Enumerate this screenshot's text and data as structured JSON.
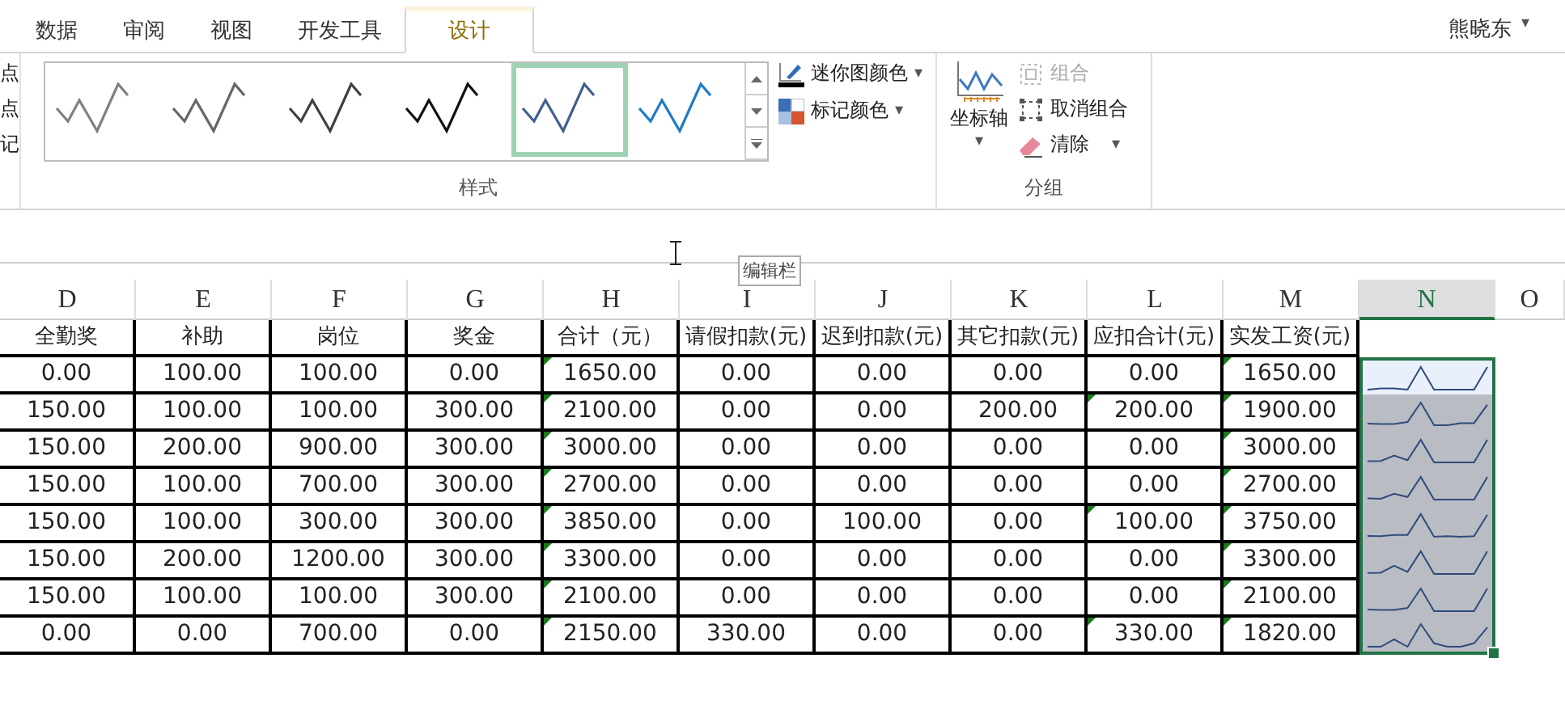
{
  "ribbon": {
    "tabs": [
      {
        "label": "数据",
        "selected": false
      },
      {
        "label": "审阅",
        "selected": false
      },
      {
        "label": "视图",
        "selected": false
      },
      {
        "label": "开发工具",
        "selected": false
      },
      {
        "label": "设计",
        "selected": true
      }
    ],
    "user": {
      "name": "熊晓东",
      "caret": "▾"
    },
    "left_labels": [
      "点",
      "点",
      "记"
    ],
    "styles": {
      "label": "样式",
      "items": [
        {
          "color": "#808080",
          "selected": false
        },
        {
          "color": "#666666",
          "selected": false
        },
        {
          "color": "#404040",
          "selected": false
        },
        {
          "color": "#111111",
          "selected": false
        },
        {
          "color": "#41608f",
          "selected": true
        },
        {
          "color": "#1f7ac6",
          "selected": false
        }
      ]
    },
    "color_buttons": [
      {
        "kind": "pen",
        "label": "迷你图颜色",
        "caret": "▾"
      },
      {
        "kind": "marker",
        "label": "标记颜色",
        "caret": "▾"
      }
    ],
    "group": {
      "label": "分组",
      "axis": {
        "label": "坐标轴",
        "caret": "▾"
      },
      "items": [
        {
          "kind": "group",
          "label": "组合",
          "disabled": true
        },
        {
          "kind": "ungroup",
          "label": "取消组合",
          "disabled": false
        },
        {
          "kind": "clear",
          "label": "清除",
          "disabled": false,
          "caret": "▾"
        }
      ]
    }
  },
  "tooltip": "编辑栏",
  "sheet": {
    "columns": [
      {
        "label": "D",
        "selected": false
      },
      {
        "label": "E",
        "selected": false
      },
      {
        "label": "F",
        "selected": false
      },
      {
        "label": "G",
        "selected": false
      },
      {
        "label": "H",
        "selected": false
      },
      {
        "label": "I",
        "selected": false
      },
      {
        "label": "J",
        "selected": false
      },
      {
        "label": "K",
        "selected": false
      },
      {
        "label": "L",
        "selected": false
      },
      {
        "label": "M",
        "selected": false
      },
      {
        "label": "N",
        "selected": true
      },
      {
        "label": "O",
        "selected": false
      }
    ],
    "headers": [
      "全勤奖",
      "补助",
      "岗位",
      "奖金",
      "合计（元）",
      "请假扣款(元)",
      "迟到扣款(元)",
      "其它扣款(元)",
      "应扣合计(元)",
      "实发工资(元)"
    ],
    "rows": [
      {
        "active": true,
        "cells": [
          {
            "text": "0.00",
            "flagged": false
          },
          {
            "text": "100.00",
            "flagged": false
          },
          {
            "text": "100.00",
            "flagged": false
          },
          {
            "text": "0.00",
            "flagged": false
          },
          {
            "text": "1650.00",
            "flagged": true
          },
          {
            "text": "0.00",
            "flagged": false
          },
          {
            "text": "0.00",
            "flagged": false
          },
          {
            "text": "0.00",
            "flagged": false
          },
          {
            "text": "0.00",
            "flagged": false
          },
          {
            "text": "1650.00",
            "flagged": true
          }
        ]
      },
      {
        "active": false,
        "cells": [
          {
            "text": "150.00",
            "flagged": false
          },
          {
            "text": "100.00",
            "flagged": false
          },
          {
            "text": "100.00",
            "flagged": false
          },
          {
            "text": "300.00",
            "flagged": false
          },
          {
            "text": "2100.00",
            "flagged": true
          },
          {
            "text": "0.00",
            "flagged": false
          },
          {
            "text": "0.00",
            "flagged": false
          },
          {
            "text": "200.00",
            "flagged": false
          },
          {
            "text": "200.00",
            "flagged": true
          },
          {
            "text": "1900.00",
            "flagged": true
          }
        ]
      },
      {
        "active": false,
        "cells": [
          {
            "text": "150.00",
            "flagged": false
          },
          {
            "text": "200.00",
            "flagged": false
          },
          {
            "text": "900.00",
            "flagged": false
          },
          {
            "text": "300.00",
            "flagged": false
          },
          {
            "text": "3000.00",
            "flagged": true
          },
          {
            "text": "0.00",
            "flagged": false
          },
          {
            "text": "0.00",
            "flagged": false
          },
          {
            "text": "0.00",
            "flagged": false
          },
          {
            "text": "0.00",
            "flagged": false
          },
          {
            "text": "3000.00",
            "flagged": true
          }
        ]
      },
      {
        "active": false,
        "cells": [
          {
            "text": "150.00",
            "flagged": false
          },
          {
            "text": "100.00",
            "flagged": false
          },
          {
            "text": "700.00",
            "flagged": false
          },
          {
            "text": "300.00",
            "flagged": false
          },
          {
            "text": "2700.00",
            "flagged": true
          },
          {
            "text": "0.00",
            "flagged": false
          },
          {
            "text": "0.00",
            "flagged": false
          },
          {
            "text": "0.00",
            "flagged": false
          },
          {
            "text": "0.00",
            "flagged": false
          },
          {
            "text": "2700.00",
            "flagged": true
          }
        ]
      },
      {
        "active": false,
        "cells": [
          {
            "text": "150.00",
            "flagged": false
          },
          {
            "text": "100.00",
            "flagged": false
          },
          {
            "text": "300.00",
            "flagged": false
          },
          {
            "text": "300.00",
            "flagged": false
          },
          {
            "text": "3850.00",
            "flagged": true
          },
          {
            "text": "0.00",
            "flagged": false
          },
          {
            "text": "100.00",
            "flagged": false
          },
          {
            "text": "0.00",
            "flagged": false
          },
          {
            "text": "100.00",
            "flagged": true
          },
          {
            "text": "3750.00",
            "flagged": true
          }
        ]
      },
      {
        "active": false,
        "cells": [
          {
            "text": "150.00",
            "flagged": false
          },
          {
            "text": "200.00",
            "flagged": false
          },
          {
            "text": "1200.00",
            "flagged": false
          },
          {
            "text": "300.00",
            "flagged": false
          },
          {
            "text": "3300.00",
            "flagged": true
          },
          {
            "text": "0.00",
            "flagged": false
          },
          {
            "text": "0.00",
            "flagged": false
          },
          {
            "text": "0.00",
            "flagged": false
          },
          {
            "text": "0.00",
            "flagged": false
          },
          {
            "text": "3300.00",
            "flagged": true
          }
        ]
      },
      {
        "active": false,
        "cells": [
          {
            "text": "150.00",
            "flagged": false
          },
          {
            "text": "100.00",
            "flagged": false
          },
          {
            "text": "100.00",
            "flagged": false
          },
          {
            "text": "300.00",
            "flagged": false
          },
          {
            "text": "2100.00",
            "flagged": true
          },
          {
            "text": "0.00",
            "flagged": false
          },
          {
            "text": "0.00",
            "flagged": false
          },
          {
            "text": "0.00",
            "flagged": false
          },
          {
            "text": "0.00",
            "flagged": false
          },
          {
            "text": "2100.00",
            "flagged": true
          }
        ]
      },
      {
        "active": false,
        "cells": [
          {
            "text": "0.00",
            "flagged": false
          },
          {
            "text": "0.00",
            "flagged": false
          },
          {
            "text": "700.00",
            "flagged": false
          },
          {
            "text": "0.00",
            "flagged": false
          },
          {
            "text": "2150.00",
            "flagged": true
          },
          {
            "text": "330.00",
            "flagged": false
          },
          {
            "text": "0.00",
            "flagged": false
          },
          {
            "text": "0.00",
            "flagged": false
          },
          {
            "text": "330.00",
            "flagged": true
          },
          {
            "text": "1820.00",
            "flagged": true
          }
        ]
      }
    ]
  }
}
